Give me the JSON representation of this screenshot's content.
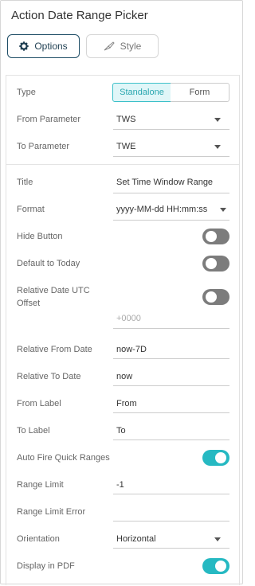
{
  "panel": {
    "title": "Action Date Range Picker",
    "tabs": [
      {
        "label": "Options",
        "icon": "gear-icon"
      },
      {
        "label": "Style",
        "icon": "brush-icon"
      }
    ]
  },
  "fields": {
    "type": {
      "label": "Type",
      "options": [
        "Standalone",
        "Form"
      ],
      "selected": "Standalone"
    },
    "from_parameter": {
      "label": "From Parameter",
      "value": "TWS"
    },
    "to_parameter": {
      "label": "To Parameter",
      "value": "TWE"
    },
    "title": {
      "label": "Title",
      "value": "Set Time Window Range"
    },
    "format": {
      "label": "Format",
      "value": "yyyy-MM-dd HH:mm:ss"
    },
    "hide_button": {
      "label": "Hide Button",
      "on": false
    },
    "default_to_today": {
      "label": "Default to Today",
      "on": false
    },
    "relative_utc": {
      "label": "Relative Date UTC Offset",
      "on": false,
      "placeholder": "+0000"
    },
    "relative_from_date": {
      "label": "Relative From Date",
      "value": "now-7D"
    },
    "relative_to_date": {
      "label": "Relative To Date",
      "value": "now"
    },
    "from_label": {
      "label": "From Label",
      "value": "From"
    },
    "to_label": {
      "label": "To Label",
      "value": "To"
    },
    "auto_fire": {
      "label": "Auto Fire Quick Ranges",
      "on": true
    },
    "range_limit": {
      "label": "Range Limit",
      "value": "-1"
    },
    "range_limit_error": {
      "label": "Range Limit Error",
      "value": ""
    },
    "orientation": {
      "label": "Orientation",
      "value": "Horizontal"
    },
    "display_in_pdf": {
      "label": "Display in PDF",
      "on": true
    }
  },
  "colors": {
    "accent": "#26b9c2",
    "toggle_off": "#7c7c7c",
    "active_tab_border": "#1f4e66"
  }
}
